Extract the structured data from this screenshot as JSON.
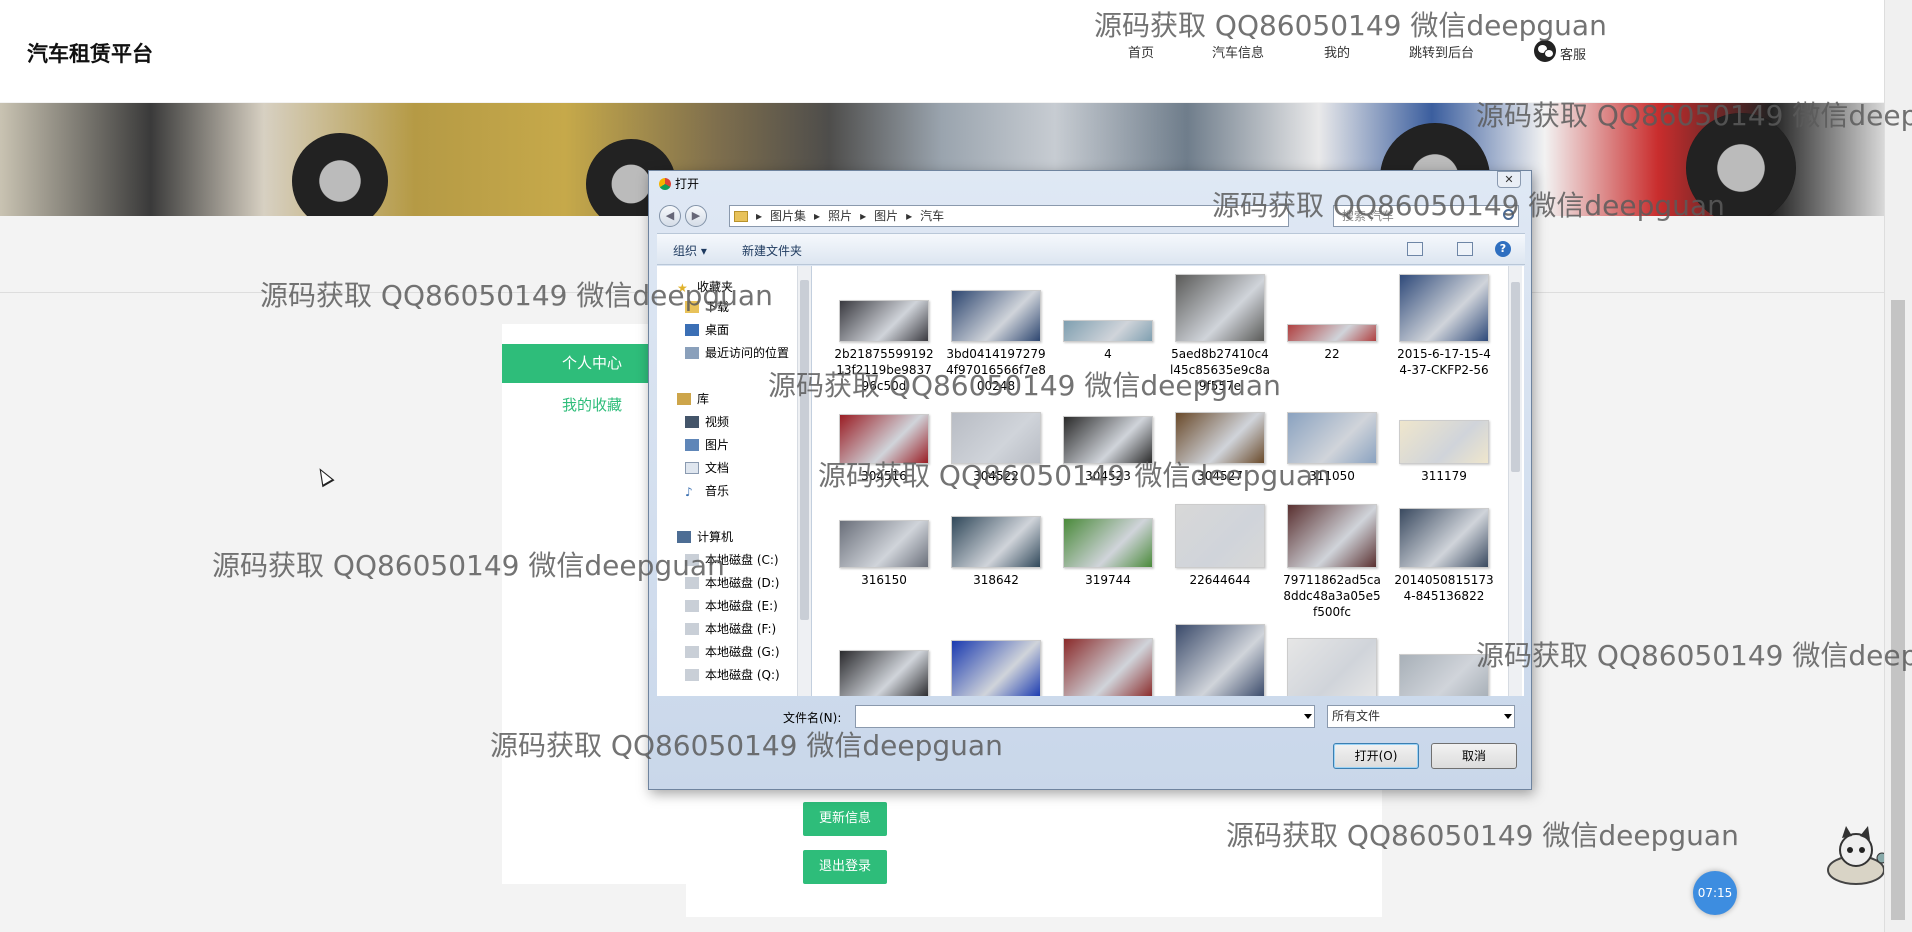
{
  "brand": "汽车租赁平台",
  "nav": {
    "home": "首页",
    "car_info": "汽车信息",
    "mine": "我的",
    "admin": "跳转到后台",
    "service": "客服"
  },
  "sidebar": {
    "active": "个人中心",
    "favorites": "我的收藏"
  },
  "main": {
    "update_btn": "更新信息",
    "logout_btn": "退出登录"
  },
  "watermark": "源码获取 QQ86050149 微信deepguan",
  "dialog": {
    "title": "打开",
    "close": "✕",
    "back": "◀",
    "forward": "▶",
    "path": [
      "图片集",
      "照片",
      "图片",
      "汽车"
    ],
    "search_placeholder": "搜索 汽车",
    "toolbar": {
      "organize": "组织 ▾",
      "new_folder": "新建文件夹",
      "help": "?"
    },
    "nav_pane": {
      "favorites": "收藏夹",
      "downloads": "下载",
      "desktop": "桌面",
      "recent": "最近访问的位置",
      "library": "库",
      "videos": "视频",
      "pictures": "图片",
      "documents": "文档",
      "music": "音乐",
      "computer": "计算机",
      "drive_c": "本地磁盘 (C:)",
      "drive_d": "本地磁盘 (D:)",
      "drive_e": "本地磁盘 (E:)",
      "drive_f": "本地磁盘 (F:)",
      "drive_g": "本地磁盘 (G:)",
      "drive_q": "本地磁盘 (Q:)"
    },
    "files": [
      {
        "name": "2b21875599192 13f2119be9837 96c50d",
        "color": "#3a3a40"
      },
      {
        "name": "3bd0414197279 4f97016566f7e8 00248",
        "color": "#2d4670"
      },
      {
        "name": "4",
        "color": "#7f9fb0"
      },
      {
        "name": "5aed8b27410c4 l45c85635e9c8a 9f557e",
        "color": "#5a5a58"
      },
      {
        "name": "22",
        "color": "#b04040"
      },
      {
        "name": "2015-6-17-15-4 4-37-CKFP2-56",
        "color": "#2f4a7a"
      },
      {
        "name": "304516",
        "color": "#9a1d24"
      },
      {
        "name": "304522",
        "color": "#b8bcc4"
      },
      {
        "name": "304523",
        "color": "#2a2a2a"
      },
      {
        "name": "304527",
        "color": "#6a4a2a"
      },
      {
        "name": "311050",
        "color": "#8aa2c0"
      },
      {
        "name": "311179",
        "color": "#efe6cc"
      },
      {
        "name": "316150",
        "color": "#6a6f7a"
      },
      {
        "name": "318642",
        "color": "#30485a"
      },
      {
        "name": "319744",
        "color": "#4a8a3a"
      },
      {
        "name": "22644644",
        "color": "#d8d8d8"
      },
      {
        "name": "79711862ad5ca 8ddc48a3a05e5 f500fc",
        "color": "#5a3030"
      },
      {
        "name": "2014050815173 4-845136822",
        "color": "#3a4a60"
      },
      {
        "name": "",
        "color": "#2b2b2e"
      },
      {
        "name": "",
        "color": "#1a3ab0"
      },
      {
        "name": "",
        "color": "#8a2a2a"
      },
      {
        "name": "",
        "color": "#3a4a6a"
      },
      {
        "name": "",
        "color": "#e6e6e6"
      },
      {
        "name": "",
        "color": "#a8b0b8"
      }
    ],
    "filename_label": "文件名(N):",
    "filename_value": "",
    "filetype": "所有文件",
    "open_btn": "打开(O)",
    "cancel_btn": "取消"
  },
  "timer": "07:15",
  "colors": {
    "accent": "#2ebd7a",
    "timer": "#3d8de0"
  }
}
